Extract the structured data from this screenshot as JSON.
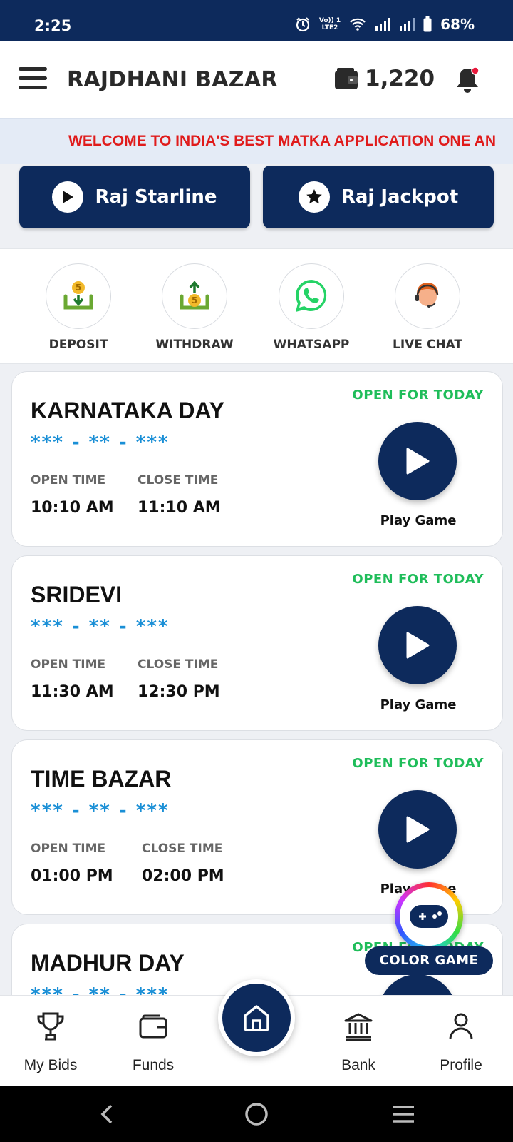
{
  "status_bar": {
    "time": "2:25",
    "network_label_top": "Vo)) 1",
    "network_label_bottom": "LTE2",
    "battery": "68%"
  },
  "header": {
    "title": "RAJDHANI BAZAR",
    "wallet_balance": "1,220"
  },
  "marquee": {
    "text": "WELCOME TO INDIA'S BEST MATKA APPLICATION ONE AN"
  },
  "top_buttons": {
    "starline": "Raj Starline",
    "jackpot": "Raj Jackpot"
  },
  "quick_actions": {
    "deposit": "DEPOSIT",
    "withdraw": "WITHDRAW",
    "whatsapp": "WHATSAPP",
    "live_chat": "LIVE CHAT"
  },
  "games": [
    {
      "name": "KARNATAKA DAY",
      "status": "OPEN FOR TODAY",
      "result": "*** - ** - ***",
      "open_label": "OPEN TIME",
      "close_label": "CLOSE TIME",
      "open_time": "10:10 AM",
      "close_time": "11:10 AM",
      "play_label": "Play Game"
    },
    {
      "name": "SRIDEVI",
      "status": "OPEN FOR TODAY",
      "result": "*** - ** - ***",
      "open_label": "OPEN TIME",
      "close_label": "CLOSE TIME",
      "open_time": "11:30 AM",
      "close_time": "12:30 PM",
      "play_label": "Play Game"
    },
    {
      "name": "TIME BAZAR",
      "status": "OPEN FOR TODAY",
      "result": "*** - ** - ***",
      "open_label": "OPEN TIME",
      "close_label": "CLOSE TIME",
      "open_time": "01:00 PM",
      "close_time": "02:00 PM",
      "play_label": "Play Game"
    },
    {
      "name": "MADHUR DAY",
      "status": "OPEN FOR TODAY",
      "result": "*** - ** - ***"
    }
  ],
  "color_game": {
    "label": "COLOR GAME"
  },
  "bottom_nav": {
    "my_bids": "My Bids",
    "funds": "Funds",
    "bank": "Bank",
    "profile": "Profile"
  },
  "colors": {
    "primary": "#0d2a5c",
    "open_status": "#1fbd5a",
    "result_digits": "#1a8fd6",
    "marquee_text": "#e01b1b"
  }
}
